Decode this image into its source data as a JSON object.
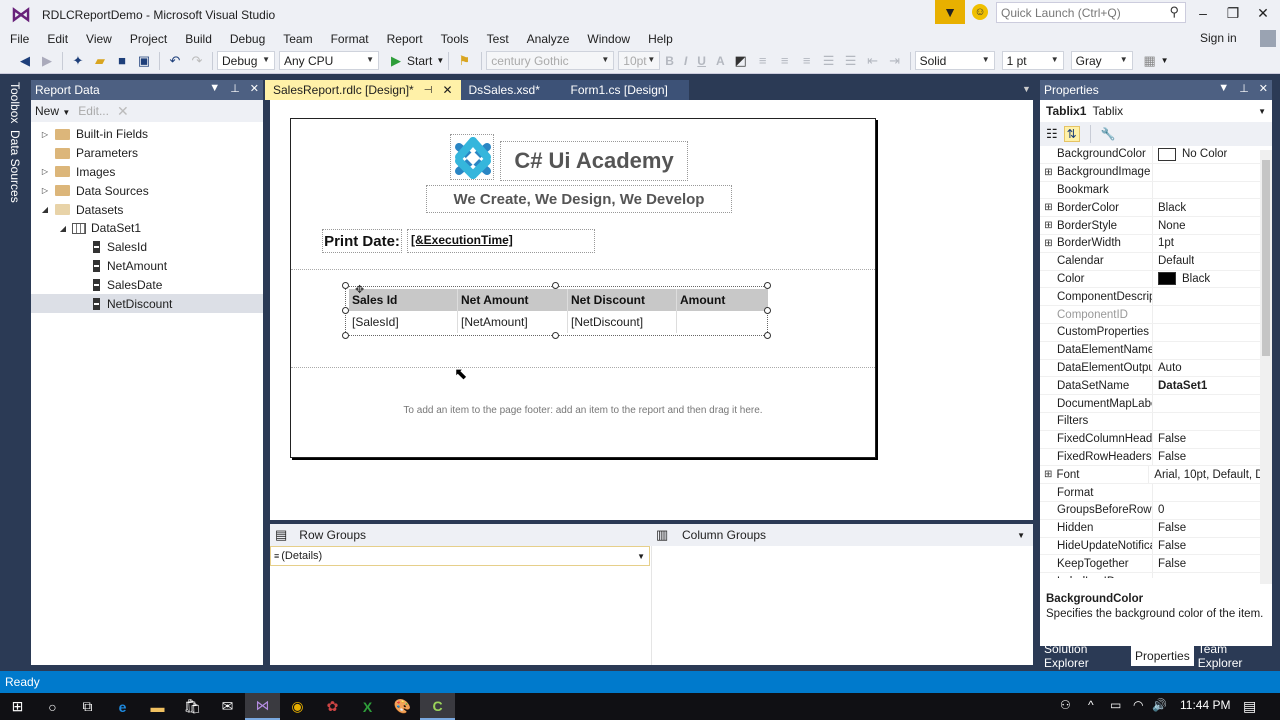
{
  "window": {
    "title": "RDLCReportDemo - Microsoft Visual Studio",
    "quick_launch_placeholder": "Quick Launch (Ctrl+Q)",
    "sign_in": "Sign in"
  },
  "menu": [
    "File",
    "Edit",
    "View",
    "Project",
    "Build",
    "Debug",
    "Team",
    "Format",
    "Report",
    "Tools",
    "Test",
    "Analyze",
    "Window",
    "Help"
  ],
  "toolbar": {
    "config": "Debug",
    "platform": "Any CPU",
    "start_label": "Start",
    "font_family": "century Gothic",
    "font_size": "10pt",
    "bold": "B",
    "italic": "I",
    "underline": "U",
    "font_color": "A",
    "border_style": "Solid",
    "border_width": "1 pt",
    "border_color": "Gray"
  },
  "left_strip": {
    "toolbox": "Toolbox",
    "data_sources": "Data Sources"
  },
  "report_data": {
    "title": "Report Data",
    "new_label": "New",
    "edit_label": "Edit...",
    "tree": [
      {
        "label": "Built-in Fields",
        "type": "folder",
        "level": 0,
        "expander": "collapsed"
      },
      {
        "label": "Parameters",
        "type": "folder",
        "level": 0,
        "expander": "none"
      },
      {
        "label": "Images",
        "type": "folder",
        "level": 0,
        "expander": "collapsed"
      },
      {
        "label": "Data Sources",
        "type": "folder",
        "level": 0,
        "expander": "collapsed"
      },
      {
        "label": "Datasets",
        "type": "folder-open",
        "level": 0,
        "expander": "expanded"
      },
      {
        "label": "DataSet1",
        "type": "dataset",
        "level": 1,
        "expander": "expanded"
      },
      {
        "label": "SalesId",
        "type": "field",
        "level": 2,
        "expander": "none"
      },
      {
        "label": "NetAmount",
        "type": "field",
        "level": 2,
        "expander": "none"
      },
      {
        "label": "SalesDate",
        "type": "field",
        "level": 2,
        "expander": "none"
      },
      {
        "label": "NetDiscount",
        "type": "field",
        "level": 2,
        "expander": "none",
        "selected": true
      }
    ]
  },
  "doc_tabs": [
    {
      "label": "SalesReport.rdlc [Design]*",
      "active": true
    },
    {
      "label": "DsSales.xsd*",
      "active": false
    },
    {
      "label": "Form1.cs [Design]",
      "active": false
    }
  ],
  "report": {
    "brand_title": "C# Ui Academy",
    "tagline": "We Create, We Design, We Develop",
    "print_date_label": "Print Date:",
    "print_date_value": "[&ExecutionTime]",
    "table": {
      "headers": [
        "Sales Id",
        "Net Amount",
        "Net Discount",
        "Amount"
      ],
      "row": [
        "[SalesId]",
        "[NetAmount]",
        "[NetDiscount]",
        ""
      ]
    },
    "footer_hint": "To add an item to the page footer: add an item to the report and then drag it here."
  },
  "groups": {
    "row_groups_label": "Row Groups",
    "column_groups_label": "Column Groups",
    "row_group_item": "(Details)"
  },
  "properties": {
    "title": "Properties",
    "object_name": "Tablix1",
    "object_type": "Tablix",
    "rows": [
      {
        "name": "BackgroundColor",
        "value": "No Color",
        "swatch": "#ffffff",
        "expandable": false
      },
      {
        "name": "BackgroundImage",
        "value": "",
        "expandable": true
      },
      {
        "name": "Bookmark",
        "value": "",
        "expandable": false
      },
      {
        "name": "BorderColor",
        "value": "Black",
        "expandable": true
      },
      {
        "name": "BorderStyle",
        "value": "None",
        "expandable": true
      },
      {
        "name": "BorderWidth",
        "value": "1pt",
        "expandable": true
      },
      {
        "name": "Calendar",
        "value": "Default",
        "expandable": false
      },
      {
        "name": "Color",
        "value": "Black",
        "swatch": "#000000",
        "expandable": false
      },
      {
        "name": "ComponentDescription",
        "value": "",
        "expandable": false
      },
      {
        "name": "ComponentID",
        "value": "",
        "expandable": false,
        "disabled": true
      },
      {
        "name": "CustomProperties",
        "value": "",
        "expandable": false
      },
      {
        "name": "DataElementName",
        "value": "",
        "expandable": false
      },
      {
        "name": "DataElementOutput",
        "value": "Auto",
        "expandable": false
      },
      {
        "name": "DataSetName",
        "value": "DataSet1",
        "expandable": false,
        "bold": true
      },
      {
        "name": "DocumentMapLabel",
        "value": "",
        "expandable": false
      },
      {
        "name": "Filters",
        "value": "",
        "expandable": false
      },
      {
        "name": "FixedColumnHeaders",
        "value": "False",
        "expandable": false
      },
      {
        "name": "FixedRowHeaders",
        "value": "False",
        "expandable": false
      },
      {
        "name": "Font",
        "value": "Arial, 10pt, Default, D",
        "expandable": true
      },
      {
        "name": "Format",
        "value": "",
        "expandable": false
      },
      {
        "name": "GroupsBeforeRowHeaders",
        "value": "0",
        "expandable": false
      },
      {
        "name": "Hidden",
        "value": "False",
        "expandable": false
      },
      {
        "name": "HideUpdateNotifications",
        "value": "False",
        "expandable": false
      },
      {
        "name": "KeepTogether",
        "value": "False",
        "expandable": false
      },
      {
        "name": "LabelLocID",
        "value": "",
        "expandable": false
      }
    ],
    "desc_title": "BackgroundColor",
    "desc_text": "Specifies the background color of the item."
  },
  "bottom_tabs": [
    {
      "label": "Solution Explorer",
      "active": false
    },
    {
      "label": "Properties",
      "active": true
    },
    {
      "label": "Team Explorer",
      "active": false
    }
  ],
  "status": {
    "text": "Ready"
  },
  "taskbar": {
    "apps": [
      "start",
      "cortana",
      "task-view",
      "edge",
      "file-explorer",
      "store",
      "mail",
      "visual-studio",
      "chrome",
      "paint-app",
      "excel",
      "paint",
      "camtasia"
    ],
    "active": [
      "visual-studio",
      "camtasia"
    ],
    "time": "11:44 PM"
  },
  "colors": {
    "accent": "#007acc",
    "vs_purple": "#68217a",
    "active_tab": "#fff1a8",
    "panel_title": "#4d6082"
  }
}
